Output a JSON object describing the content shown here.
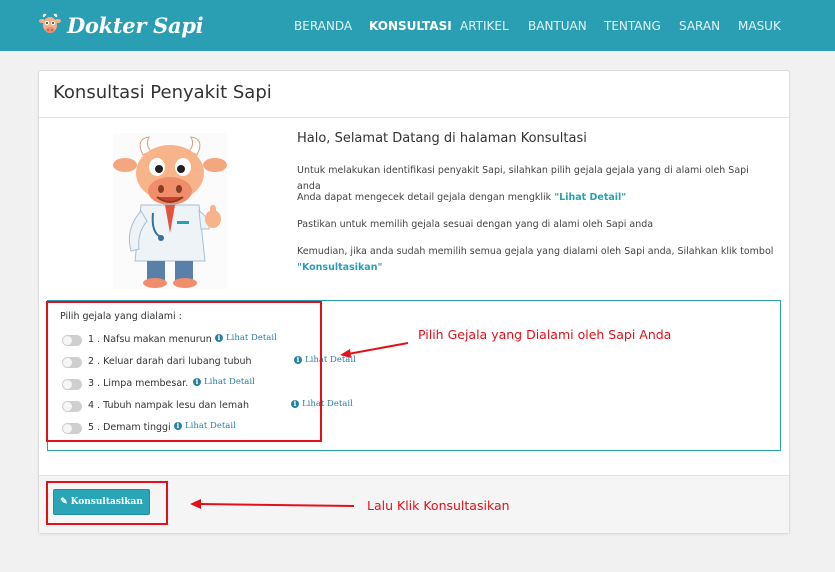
{
  "brand": {
    "name": "Dokter Sapi"
  },
  "nav": {
    "items": [
      {
        "label": "BERANDA",
        "active": false
      },
      {
        "label": "KONSULTASI",
        "active": true
      },
      {
        "label": "ARTIKEL",
        "active": false
      },
      {
        "label": "BANTUAN",
        "active": false
      },
      {
        "label": "TENTANG",
        "active": false
      },
      {
        "label": "SARAN",
        "active": false
      },
      {
        "label": "MASUK",
        "active": false
      }
    ]
  },
  "panel": {
    "title": "Konsultasi Penyakit Sapi",
    "intro_title": "Halo, Selamat Datang di halaman Konsultasi",
    "p1": "Untuk melakukan identifikasi penyakit Sapi, silahkan pilih gejala gejala yang di alami oleh Sapi anda",
    "p2_prefix": "Anda dapat mengecek detail gejala dengan mengklik",
    "p2_link": "\"Lihat Detail\"",
    "p3": "Pastikan untuk memilih gejala sesuai dengan yang di alami oleh Sapi anda",
    "p4_prefix": "Kemudian, jika anda sudah memilih semua gejala yang dialami oleh Sapi anda, Silahkan klik tombol",
    "p4_link": "\"Konsultasikan\""
  },
  "symptoms": {
    "label": "Pilih gejala yang dialami :",
    "detail_label": "Lihat Detail",
    "items": [
      {
        "text": "1 . Nafsu makan menurun",
        "checked": false
      },
      {
        "text": "2 . Keluar darah dari lubang tubuh",
        "checked": false
      },
      {
        "text": "3 . Limpa membesar.",
        "checked": false
      },
      {
        "text": "4 . Tubuh nampak lesu dan lemah",
        "checked": false
      },
      {
        "text": "5 . Demam tinggi",
        "checked": false
      }
    ]
  },
  "footer": {
    "button_label": "Konsultasikan"
  },
  "annotations": {
    "symptoms_note": "Pilih Gejala yang Dialami oleh Sapi Anda",
    "button_note": "Lalu Klik Konsultasikan"
  },
  "colors": {
    "primary": "#2a9fb4",
    "annotation": "#e3101a"
  },
  "icons": {
    "brand": "cow-logo-icon",
    "detail": "info-circle-icon",
    "button": "pencil-icon"
  }
}
